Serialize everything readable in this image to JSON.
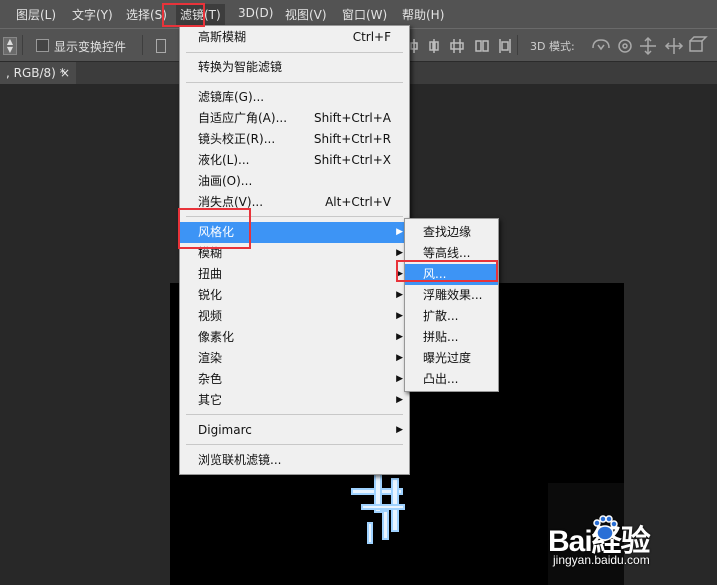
{
  "menubar": {
    "items": [
      "图层(L)",
      "文字(Y)",
      "选择(S)",
      "滤镜(T)",
      "3D(D)",
      "视图(V)",
      "窗口(W)",
      "帮助(H)"
    ]
  },
  "options": {
    "show_transform_label": "显示变换控件",
    "mode_3d_label": "3D 模式:"
  },
  "document_tab": {
    "title": ", RGB/8) *",
    "close": "×"
  },
  "filter_menu": {
    "items": [
      {
        "label": "高斯模糊",
        "shortcut": "Ctrl+F"
      },
      {
        "label": "转换为智能滤镜",
        "shortcut": ""
      },
      {
        "label": "滤镜库(G)...",
        "shortcut": ""
      },
      {
        "label": "自适应广角(A)...",
        "shortcut": "Shift+Ctrl+A"
      },
      {
        "label": "镜头校正(R)...",
        "shortcut": "Shift+Ctrl+R"
      },
      {
        "label": "液化(L)...",
        "shortcut": "Shift+Ctrl+X"
      },
      {
        "label": "油画(O)...",
        "shortcut": ""
      },
      {
        "label": "消失点(V)...",
        "shortcut": "Alt+Ctrl+V"
      },
      {
        "label": "风格化",
        "shortcut": ""
      },
      {
        "label": "模糊",
        "shortcut": ""
      },
      {
        "label": "扭曲",
        "shortcut": ""
      },
      {
        "label": "锐化",
        "shortcut": ""
      },
      {
        "label": "视频",
        "shortcut": ""
      },
      {
        "label": "像素化",
        "shortcut": ""
      },
      {
        "label": "渲染",
        "shortcut": ""
      },
      {
        "label": "杂色",
        "shortcut": ""
      },
      {
        "label": "其它",
        "shortcut": ""
      },
      {
        "label": "Digimarc",
        "shortcut": ""
      },
      {
        "label": "浏览联机滤镜...",
        "shortcut": ""
      }
    ]
  },
  "stylize_submenu": {
    "items": [
      "查找边缘",
      "等高线...",
      "风...",
      "浮雕效果...",
      "扩散...",
      "拼贴...",
      "曝光过度",
      "凸出..."
    ]
  },
  "watermark": {
    "brand": "Bai経验",
    "url": "jingyan.baidu.com"
  },
  "colors": {
    "highlight": "#3d94f5",
    "annotation_red": "#e8333a",
    "menubar": "#535353"
  }
}
